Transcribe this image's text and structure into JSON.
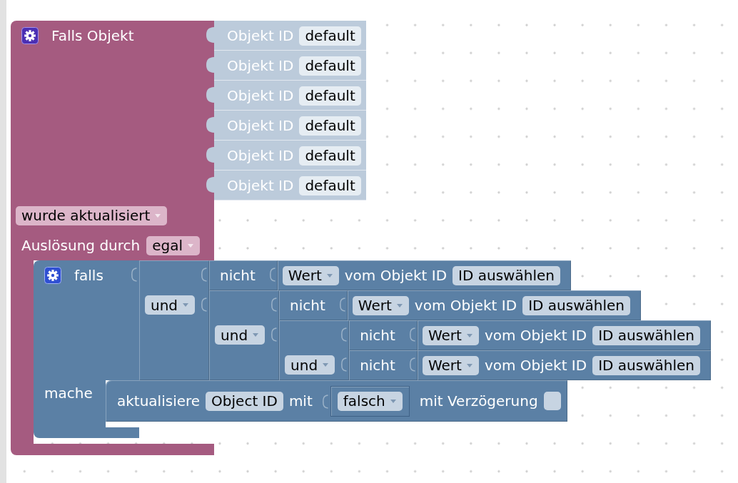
{
  "workspace": {
    "blocks": [
      {
        "kind": "trigger",
        "title": "Falls Objekt",
        "object_ids": [
          {
            "label": "Objekt ID",
            "value": "default"
          },
          {
            "label": "Objekt ID",
            "value": "default"
          },
          {
            "label": "Objekt ID",
            "value": "default"
          },
          {
            "label": "Objekt ID",
            "value": "default"
          },
          {
            "label": "Objekt ID",
            "value": "default"
          },
          {
            "label": "Objekt ID",
            "value": "default"
          }
        ],
        "event": "wurde aktualisiert",
        "trigger_label": "Auslösung durch",
        "trigger_value": "egal",
        "statements": [
          {
            "kind": "if",
            "label": "falls",
            "condition": {
              "kind": "and",
              "operator": "und",
              "inputs": [
                {
                  "kind": "not",
                  "label": "nicht",
                  "input": {
                    "kind": "get_value",
                    "attribute": "Wert",
                    "label": "vom Objekt ID",
                    "object_id": "ID auswählen"
                  }
                },
                {
                  "kind": "and",
                  "operator": "und",
                  "inputs": [
                    {
                      "kind": "not",
                      "label": "nicht",
                      "input": {
                        "kind": "get_value",
                        "attribute": "Wert",
                        "label": "vom Objekt ID",
                        "object_id": "ID auswählen"
                      }
                    },
                    {
                      "kind": "and",
                      "operator": "und",
                      "inputs": [
                        {
                          "kind": "not",
                          "label": "nicht",
                          "input": {
                            "kind": "get_value",
                            "attribute": "Wert",
                            "label": "vom Objekt ID",
                            "object_id": "ID auswählen"
                          }
                        },
                        {
                          "kind": "not",
                          "label": "nicht",
                          "input": {
                            "kind": "get_value",
                            "attribute": "Wert",
                            "label": "vom Objekt ID",
                            "object_id": "ID auswählen"
                          }
                        }
                      ]
                    }
                  ]
                }
              ]
            },
            "do_label": "mache",
            "statements": [
              {
                "kind": "update",
                "label": "aktualisiere",
                "object_id": "Object ID",
                "with_label": "mit",
                "value": {
                  "kind": "boolean",
                  "value": "falsch"
                },
                "delay_label": "mit Verzögerung",
                "delay": false
              }
            ]
          }
        ]
      }
    ]
  }
}
